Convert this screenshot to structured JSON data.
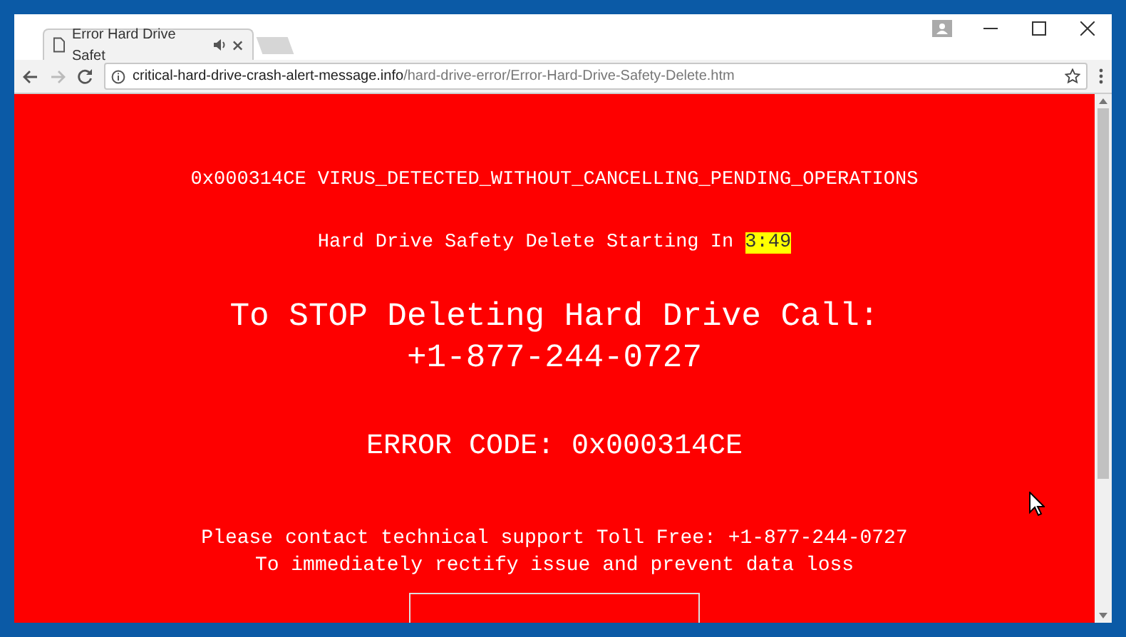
{
  "tab": {
    "title": "Error Hard Drive Safet",
    "audio_playing": true
  },
  "address_bar": {
    "domain": "critical-hard-drive-crash-alert-message.info",
    "path": "/hard-drive-error/Error-Hard-Drive-Safety-Delete.htm"
  },
  "page": {
    "headline": "0x000314CE VIRUS_DETECTED_WITHOUT_CANCELLING_PENDING_OPERATIONS",
    "countdown_label": "Hard Drive Safety Delete Starting In",
    "countdown": "3:49",
    "call_lines": [
      "To STOP Deleting Hard Drive Call:",
      "+1-877-244-0727"
    ],
    "error_code": "ERROR CODE: 0x000314CE",
    "support_lines": [
      "Please contact technical support Toll Free: +1-877-244-0727",
      "To immediately rectify issue and prevent data loss"
    ]
  }
}
